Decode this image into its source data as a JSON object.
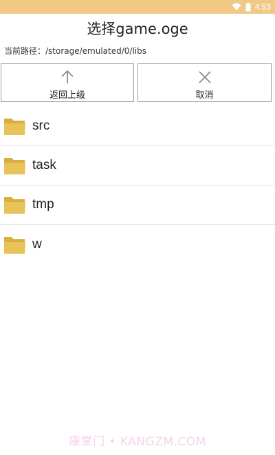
{
  "status_bar": {
    "time": "4:53",
    "bg_color": "#f0c987",
    "icons": [
      "wifi-icon",
      "battery-icon"
    ]
  },
  "dialog": {
    "title": "选择game.oge",
    "path_label": "当前路径：/storage/emulated/0/libs"
  },
  "toolbar": {
    "back_label": "返回上级",
    "back_icon": "arrow-up-icon",
    "cancel_label": "取消",
    "cancel_icon": "close-icon"
  },
  "files": [
    {
      "name": "src",
      "icon": "folder-icon"
    },
    {
      "name": "task",
      "icon": "folder-icon"
    },
    {
      "name": "tmp",
      "icon": "folder-icon"
    },
    {
      "name": "w",
      "icon": "folder-icon"
    }
  ],
  "watermark": "康掌门 • KANGZM.COM",
  "colors": {
    "folder": "#e8c35a",
    "folder_tab": "#d9ae3f",
    "divider": "#e4e4e4"
  }
}
